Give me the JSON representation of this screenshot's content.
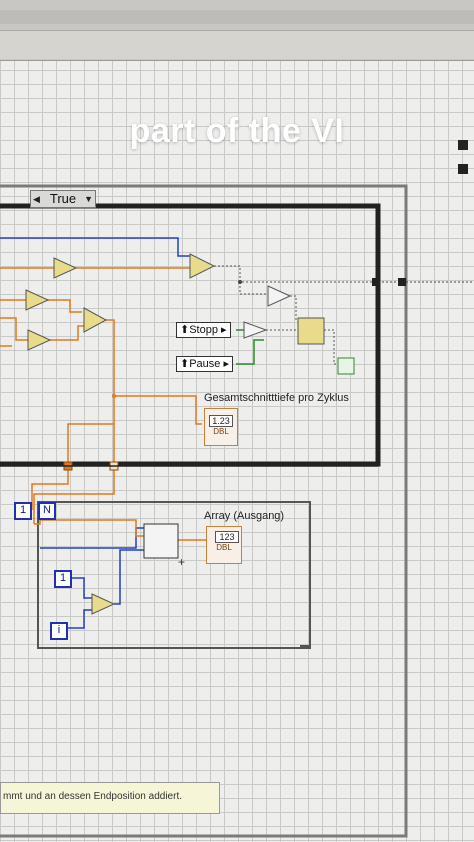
{
  "overlay": {
    "title": "part of the VI"
  },
  "case_structure": {
    "selector_value": "True"
  },
  "controls": {
    "stop": "Stopp",
    "pause": "Pause"
  },
  "indicators": {
    "avg_depth_label": "Gesamtschnitttiefe pro Zyklus",
    "avg_depth_type": "DBL",
    "avg_depth_value": "1.23",
    "array_label": "Array (Ausgang)",
    "array_type": "DBL",
    "array_value": "123"
  },
  "for_loop": {
    "count_const": "1",
    "count_terminal": "N",
    "iteration_terminal": "i"
  },
  "constants": {
    "one": "1"
  },
  "comment": {
    "text": "mmt und an dessen Endposition addiert."
  },
  "colors": {
    "wire_double": "#e07a20",
    "wire_int": "#2040c0",
    "bool_wire": "#2a8a2a",
    "structure_border": "#333333"
  }
}
